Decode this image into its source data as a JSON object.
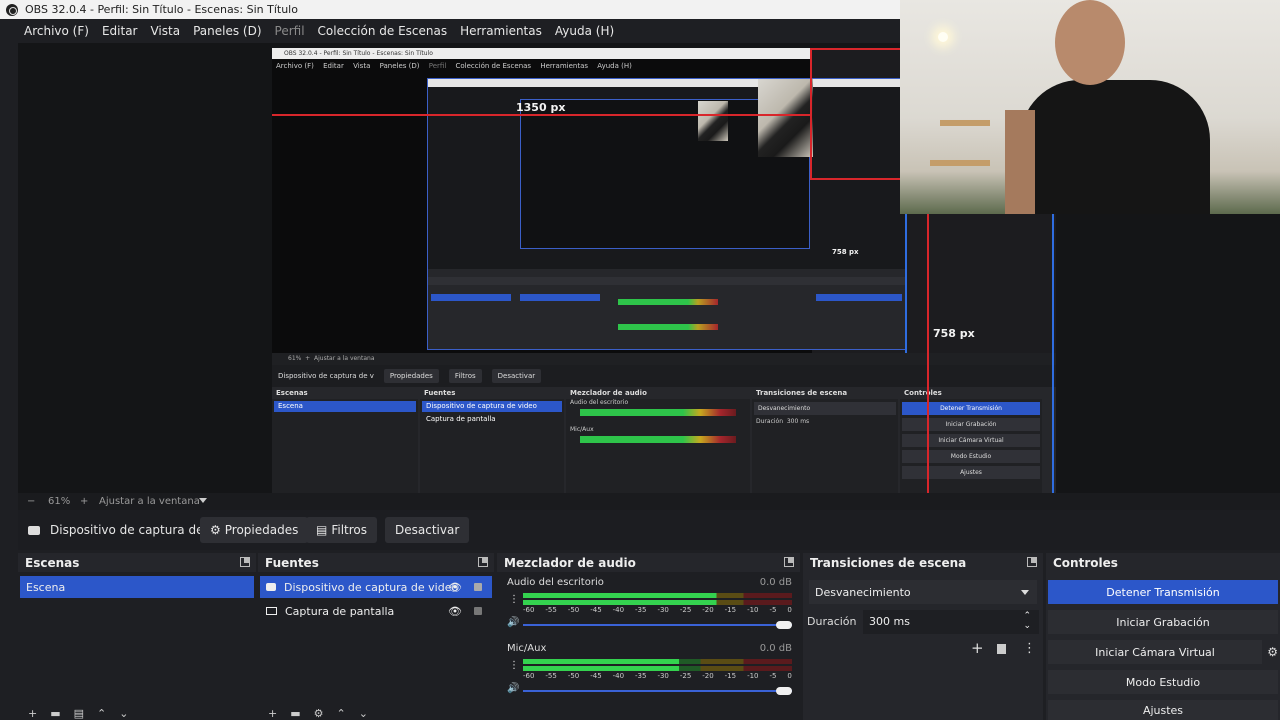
{
  "window": {
    "title": "OBS 32.0.4 - Perfil: Sin Título - Escenas: Sin Título"
  },
  "menu": {
    "items": [
      "Archivo (F)",
      "Editar",
      "Vista",
      "Paneles (D)",
      "Perfil",
      "Colección de Escenas",
      "Herramientas",
      "Ayuda (H)"
    ]
  },
  "preview": {
    "measure_width": "1350 px",
    "measure_height": "758 px",
    "measure_height_small": "758 px",
    "measure_width_small": "1350 px",
    "measure_small_w": "758 px"
  },
  "zoom": {
    "minus": "−",
    "value": "61%",
    "plus": "+",
    "fit": "Ajustar a la ventana"
  },
  "source_toolbar": {
    "source_name": "Dispositivo de captura de v",
    "properties": "Propiedades",
    "filters": "Filtros",
    "deactivate": "Desactivar"
  },
  "scenes": {
    "title": "Escenas",
    "items": [
      "Escena"
    ]
  },
  "sources": {
    "title": "Fuentes",
    "items": [
      "Dispositivo de captura de video",
      "Captura de pantalla"
    ]
  },
  "mixer": {
    "title": "Mezclador de audio",
    "channels": [
      {
        "name": "Audio del escritorio",
        "db": "0.0 dB",
        "level": 0.72
      },
      {
        "name": "Mic/Aux",
        "db": "0.0 dB",
        "level": 0.58
      }
    ],
    "scale": [
      "-60",
      "-55",
      "-50",
      "-45",
      "-40",
      "-35",
      "-30",
      "-25",
      "-20",
      "-15",
      "-10",
      "-5",
      "0"
    ]
  },
  "transitions": {
    "title": "Transiciones de escena",
    "selected": "Desvanecimiento",
    "duration_label": "Duración",
    "duration_value": "300 ms"
  },
  "controls": {
    "title": "Controles",
    "buttons": [
      "Detener Transmisión",
      "Iniciar Grabación",
      "Iniciar Cámara Virtual",
      "Modo Estudio",
      "Ajustes"
    ]
  },
  "nested": {
    "title": "OBS 32.0.4 - Perfil: Sin Título - Escenas: Sin Título",
    "menu": [
      "Archivo (F)",
      "Editar",
      "Vista",
      "Paneles (D)",
      "Perfil",
      "Colección de Escenas",
      "Herramientas",
      "Ayuda (H)"
    ],
    "zoom": "61%",
    "fit": "Ajustar a la ventana",
    "source_name": "Dispositivo de captura de v",
    "properties": "Propiedades",
    "filters": "Filtros",
    "deactivate": "Desactivar",
    "scenes": "Escenas",
    "scene_item": "Escena",
    "sources": "Fuentes",
    "source_items": [
      "Dispositivo de captura de video",
      "Captura de pantalla"
    ],
    "mixer": "Mezclador de audio",
    "desktop_audio": "Audio del escritorio",
    "mic": "Mic/Aux",
    "db": "0.0 dB",
    "transitions": "Transiciones de escena",
    "transition": "Desvanecimiento",
    "duration_label": "Duración",
    "duration_value": "300 ms",
    "controls": "Controles",
    "ctrl_buttons": [
      "Detener Transmisión",
      "Iniciar Grabación",
      "Iniciar Cámara Virtual",
      "Modo Estudio",
      "Ajustes"
    ]
  },
  "colors": {
    "accent": "#2c57c9",
    "guide_red": "#d8262b",
    "guide_blue": "#2f6de0"
  }
}
